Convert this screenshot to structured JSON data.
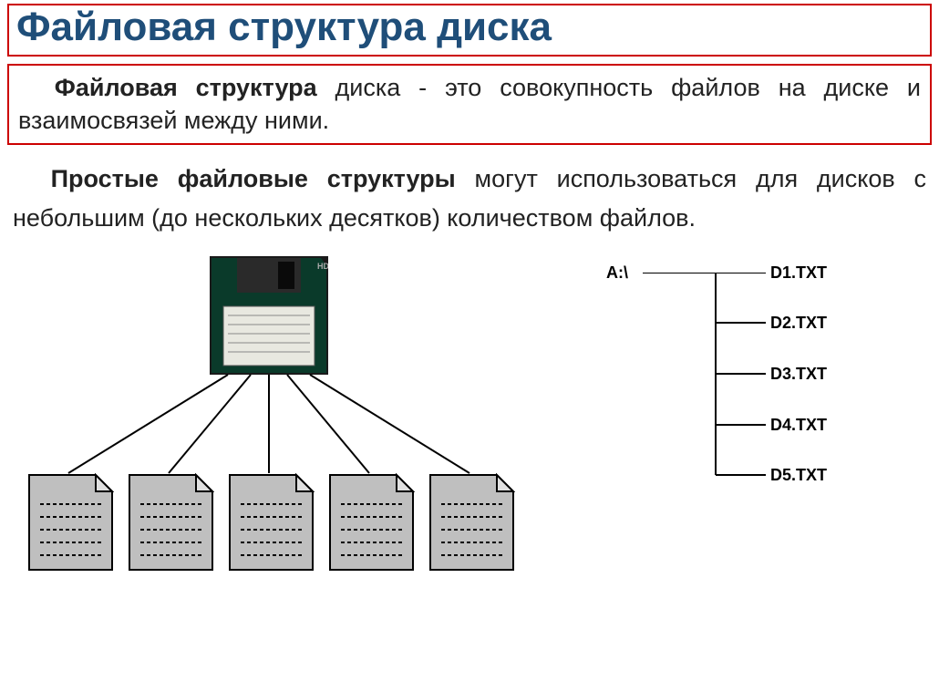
{
  "title": "Файловая структура диска",
  "definition": {
    "bold": "Файловая структура",
    "rest": " диска - это совокупность файлов на диске и взаимосвязей между ними."
  },
  "paragraph": {
    "bold": "Простые файловые структуры",
    "rest": " могут использоваться для дисков с небольшим (до нескольких десятков) количеством файлов."
  },
  "tree": {
    "root": "A:\\",
    "files": [
      "D1.TXT",
      "D2.TXT",
      "D3.TXT",
      "D4.TXT",
      "D5.TXT"
    ]
  }
}
